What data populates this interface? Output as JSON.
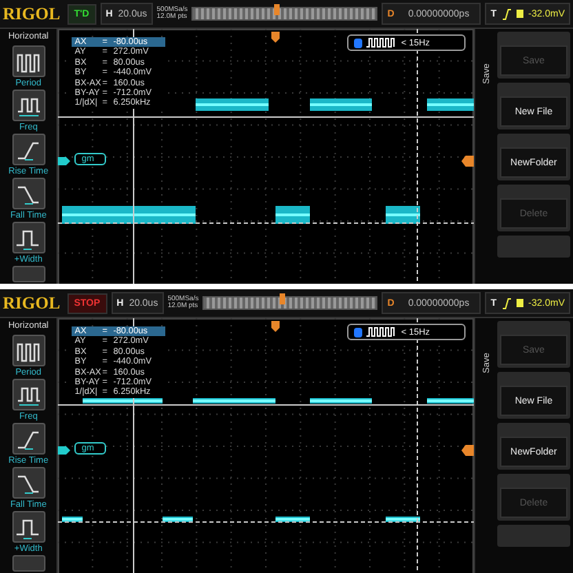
{
  "screens": [
    {
      "logo": "RIGOL",
      "run_status": {
        "label": "T'D",
        "kind": "triggered"
      },
      "timebase": {
        "key": "H",
        "value": "20.0us"
      },
      "sample_rate": "500MSa/s",
      "memory_depth": "12.0M pts",
      "delay": {
        "key": "D",
        "value": "0.00000000ps"
      },
      "trigger": {
        "key": "T",
        "reading": "-32.0mV"
      },
      "sidebar": {
        "title": "Horizontal",
        "items": [
          {
            "label": "Period"
          },
          {
            "label": "Freq"
          },
          {
            "label": "Rise Time"
          },
          {
            "label": "Fall Time"
          },
          {
            "label": "+Width"
          }
        ]
      },
      "cursor_readout": [
        {
          "name": "AX",
          "sep": "=",
          "value": "-80.00us",
          "selected": true
        },
        {
          "name": "AY",
          "sep": "=",
          "value": "272.0mV",
          "selected": false
        },
        {
          "name": "BX",
          "sep": "=",
          "value": "80.00us",
          "selected": false
        },
        {
          "name": "BY",
          "sep": "=",
          "value": "-440.0mV",
          "selected": false
        },
        {
          "name": "BX-AX",
          "sep": "=",
          "value": "160.0us",
          "selected": false
        },
        {
          "name": "BY-AY",
          "sep": "=",
          "value": "-712.0mV",
          "selected": false
        },
        {
          "name": "1/|dX|",
          "sep": "=",
          "value": "6.250kHz",
          "selected": false
        }
      ],
      "trigger_box": {
        "text": "< 15Hz"
      },
      "channel_label": "gm",
      "menu": {
        "title": "Save",
        "buttons": [
          {
            "label": "Save",
            "disabled": true
          },
          {
            "label": "New File",
            "disabled": false
          },
          {
            "label": "NewFolder",
            "disabled": false
          },
          {
            "label": "Delete",
            "disabled": true
          }
        ]
      }
    },
    {
      "logo": "RIGOL",
      "run_status": {
        "label": "STOP",
        "kind": "stopped"
      },
      "timebase": {
        "key": "H",
        "value": "20.0us"
      },
      "sample_rate": "500MSa/s",
      "memory_depth": "12.0M pts",
      "delay": {
        "key": "D",
        "value": "0.00000000ps"
      },
      "trigger": {
        "key": "T",
        "reading": "-32.0mV"
      },
      "sidebar": {
        "title": "Horizontal",
        "items": [
          {
            "label": "Period"
          },
          {
            "label": "Freq"
          },
          {
            "label": "Rise Time"
          },
          {
            "label": "Fall Time"
          },
          {
            "label": "+Width"
          }
        ]
      },
      "cursor_readout": [
        {
          "name": "AX",
          "sep": "=",
          "value": "-80.00us",
          "selected": true
        },
        {
          "name": "AY",
          "sep": "=",
          "value": "272.0mV",
          "selected": false
        },
        {
          "name": "BX",
          "sep": "=",
          "value": "80.00us",
          "selected": false
        },
        {
          "name": "BY",
          "sep": "=",
          "value": "-440.0mV",
          "selected": false
        },
        {
          "name": "BX-AX",
          "sep": "=",
          "value": "160.0us",
          "selected": false
        },
        {
          "name": "BY-AY",
          "sep": "=",
          "value": "-712.0mV",
          "selected": false
        },
        {
          "name": "1/|dX|",
          "sep": "=",
          "value": "6.250kHz",
          "selected": false
        }
      ],
      "trigger_box": {
        "text": "< 15Hz"
      },
      "channel_label": "gm",
      "menu": {
        "title": "Save",
        "buttons": [
          {
            "label": "Save",
            "disabled": true
          },
          {
            "label": "New File",
            "disabled": false
          },
          {
            "label": "NewFolder",
            "disabled": false
          },
          {
            "label": "Delete",
            "disabled": true
          }
        ]
      }
    }
  ]
}
